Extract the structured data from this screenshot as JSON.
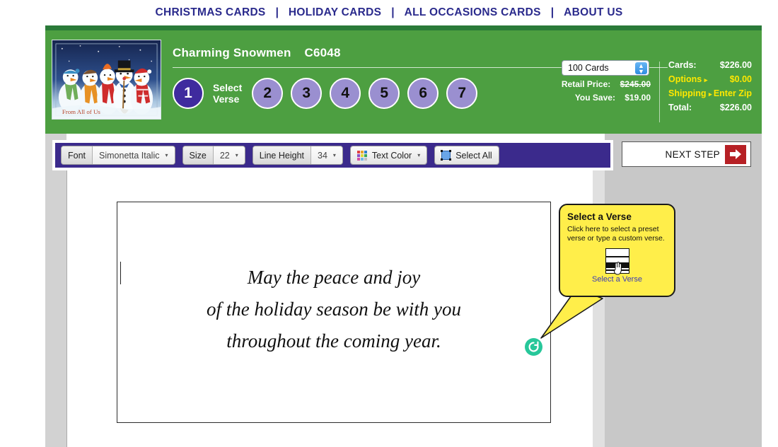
{
  "topnav": {
    "links": [
      "CHRISTMAS CARDS",
      "HOLIDAY CARDS",
      "ALL OCCASIONS CARDS",
      "ABOUT US"
    ],
    "separator": "|",
    "color": "#2a2a8c"
  },
  "header": {
    "background": "#4d9f41",
    "strip_color": "#2a7a38",
    "product_name": "Charming Snowmen",
    "sku": "C6048",
    "thumbnail_caption": "From All of Us",
    "steps": [
      {
        "number": "1",
        "label": "Select Verse",
        "active": true
      },
      {
        "number": "2",
        "active": false
      },
      {
        "number": "3",
        "active": false
      },
      {
        "number": "4",
        "active": false
      },
      {
        "number": "5",
        "active": false
      },
      {
        "number": "6",
        "active": false
      },
      {
        "number": "7",
        "active": false
      }
    ],
    "active_step_color": "#3f2b9e",
    "step_color": "#9a8fd0"
  },
  "pricing": {
    "quantity_value": "100 Cards",
    "retail_price_label": "Retail Price:",
    "retail_price_value": "$245.00",
    "you_save_label": "You Save:",
    "you_save_value": "$19.00",
    "cards_label": "Cards:",
    "cards_value": "$226.00",
    "options_label": "Options",
    "options_value": "$0.00",
    "shipping_label": "Shipping",
    "shipping_value": "Enter Zip",
    "total_label": "Total:",
    "total_value": "$226.00",
    "arrow_glyph": "▸",
    "highlight_color": "#ffe800"
  },
  "toolbar": {
    "background": "#3b2a8c",
    "font_label": "Font",
    "font_value": "Simonetta Italic",
    "size_label": "Size",
    "size_value": "22",
    "line_height_label": "Line Height",
    "line_height_value": "34",
    "text_color_label": "Text Color",
    "select_all_label": "Select All",
    "caret_glyph": "▾"
  },
  "next_step": {
    "label": "NEXT STEP",
    "arrow_color": "#b62025"
  },
  "canvas": {
    "verse_lines": [
      "May the peace and joy",
      "of the holiday season be with you",
      "throughout the coming year."
    ],
    "rotate_icon_color": "#27c79a"
  },
  "tooltip": {
    "title": "Select a Verse",
    "body": "Click here to select a preset verse or type a custom verse.",
    "link": "Select a Verse",
    "background": "#ffee4a"
  }
}
